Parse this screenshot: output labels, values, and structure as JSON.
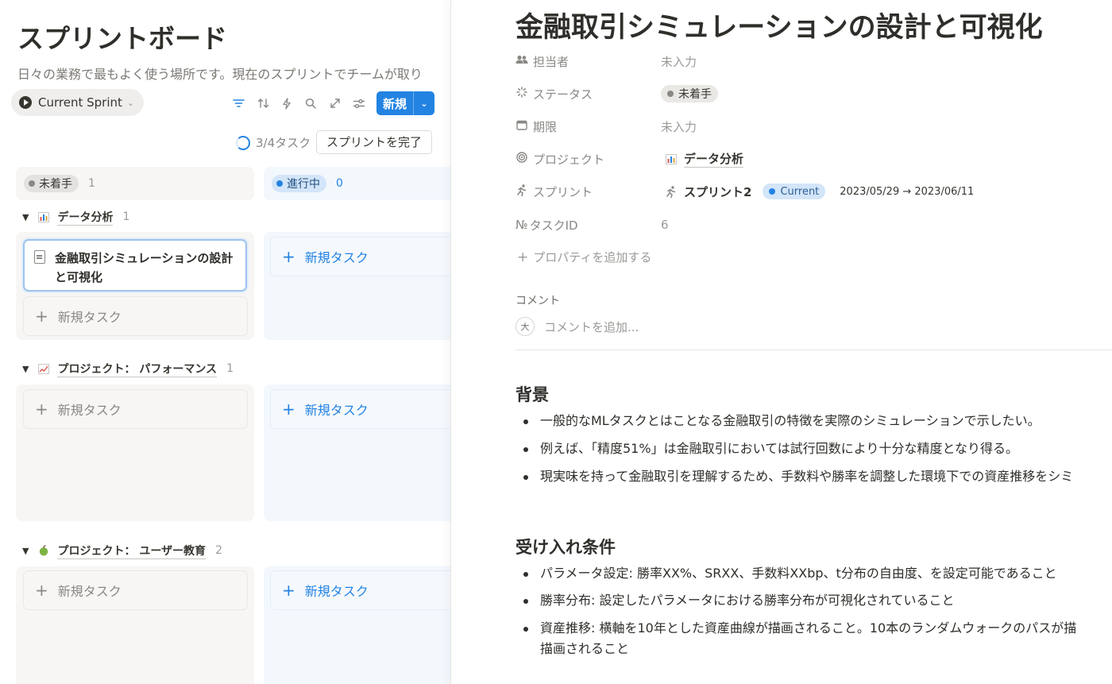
{
  "board": {
    "title": "スプリントボード",
    "description": "日々の業務で最もよく使う場所です。現在のスプリントでチームが取り",
    "view_label": "Current Sprint",
    "toolbar_icons": [
      "filter-icon",
      "sort-icon",
      "automation-icon",
      "search-icon",
      "expand-icon",
      "settings-icon"
    ],
    "new_button": "新規",
    "progress": "3/4タスク",
    "complete_button": "スプリントを完了",
    "columns": [
      {
        "status": "未着手",
        "count": "1",
        "dot_color": "#8a8884"
      },
      {
        "status": "進行中",
        "count": "0",
        "dot_color": "#2383e2"
      }
    ],
    "groups": [
      {
        "name": "データ分析",
        "count": "1",
        "icon": "bar-chart-icon"
      },
      {
        "name": "プロジェクト： パフォーマンス",
        "count": "1",
        "icon": "line-chart-icon"
      },
      {
        "name": "プロジェクト： ユーザー教育",
        "count": "2",
        "icon": "apple-icon"
      }
    ],
    "card_title": "金融取引シミュレーションの設計と可視化",
    "new_task": "新規タスク"
  },
  "panel": {
    "title": "金融取引シミュレーションの設計と可視化",
    "properties": [
      {
        "label": "担当者",
        "value": "未入力"
      },
      {
        "label": "ステータス",
        "value": "未着手"
      },
      {
        "label": "期限",
        "value": "未入力"
      },
      {
        "label": "プロジェクト",
        "value": "データ分析"
      },
      {
        "label": "スプリント",
        "value": "スプリント2",
        "tag": "Current",
        "dates": "2023/05/29 → 2023/06/11"
      },
      {
        "label": "タスクID",
        "value": "6"
      }
    ],
    "add_property": "プロパティを追加する",
    "comments_heading": "コメント",
    "avatar_initial": "大",
    "comment_placeholder": "コメントを追加...",
    "sections": [
      {
        "heading": "背景",
        "bullets": [
          "一般的なMLタスクとはことなる金融取引の特徴を実際のシミュレーションで示したい。",
          "例えば、「精度51%」は金融取引においては試行回数により十分な精度となり得る。",
          "現実味を持って金融取引を理解するため、手数料や勝率を調整した環境下での資産推移をシミ"
        ]
      },
      {
        "heading": "受け入れ条件",
        "bullets": [
          "パラメータ設定: 勝率XX%、SRXX、手数料XXbp、t分布の自由度、を設定可能であること",
          "勝率分布: 設定したパラメータにおける勝率分布が可視化されていること",
          "資産推移: 横軸を10年とした資産曲線が描画されること。10本のランダムウォークのパスが描",
          "描画されること"
        ]
      }
    ]
  }
}
